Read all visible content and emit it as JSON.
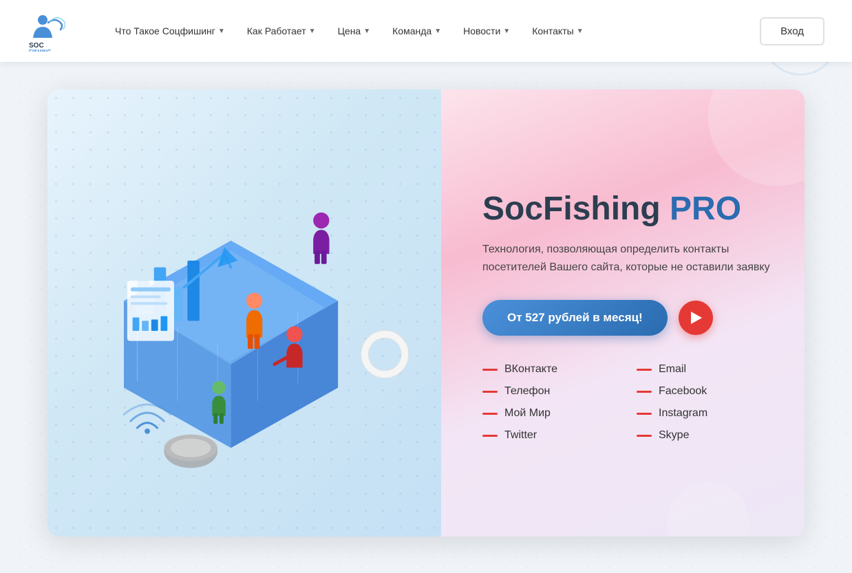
{
  "header": {
    "logo_text": "SOC FISHING",
    "nav_items": [
      {
        "label": "Что Такое Соцфишинг",
        "has_dropdown": true
      },
      {
        "label": "Как Работает",
        "has_dropdown": true
      },
      {
        "label": "Цена",
        "has_dropdown": true
      },
      {
        "label": "Команда",
        "has_dropdown": true
      },
      {
        "label": "Новости",
        "has_dropdown": true
      },
      {
        "label": "Контакты",
        "has_dropdown": true
      }
    ],
    "login_label": "Вход"
  },
  "hero": {
    "title_part1": "SocFishing ",
    "title_pro": "PRO",
    "subtitle": "Технология, позволяющая определить контакты посетителей Вашего сайта, которые не оставили заявку",
    "cta_label": "От 527 рублей в месяц!",
    "features": [
      {
        "label": "ВКонтакте",
        "col": 1
      },
      {
        "label": "Email",
        "col": 2
      },
      {
        "label": "Телефон",
        "col": 1
      },
      {
        "label": "Facebook",
        "col": 2
      },
      {
        "label": "Мой Мир",
        "col": 1
      },
      {
        "label": "Instagram",
        "col": 2
      },
      {
        "label": "Twitter",
        "col": 1
      },
      {
        "label": "Skype",
        "col": 2
      }
    ]
  },
  "colors": {
    "accent_blue": "#2b6cb0",
    "accent_red": "#e53935",
    "pro_color": "#2b6cb0"
  }
}
